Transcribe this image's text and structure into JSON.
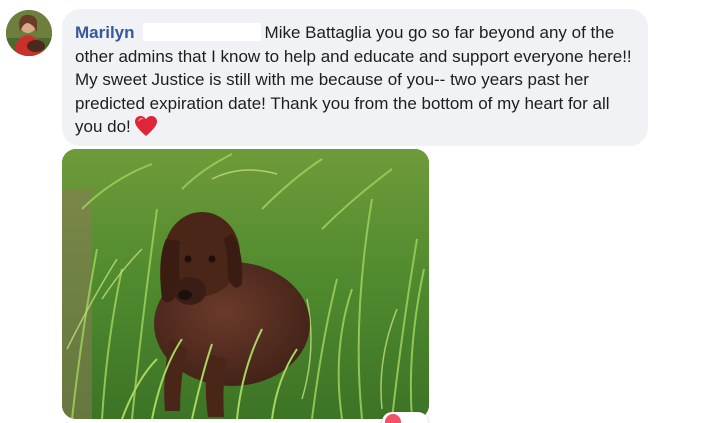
{
  "comment": {
    "author": "Marilyn",
    "text": "Mike Battaglia you go so far beyond any of the other admins that I know to help and educate and support everyone here!! My sweet Justice is still with me because of you-- two years past her predicted expiration date! Thank you from the bottom of my heart for all you do!",
    "emoji": "red-heart-icon"
  },
  "photo": {
    "subject": "dog-lying-in-grass"
  },
  "reactions": {
    "icon": "love-reaction-icon",
    "count": "",
    "color": "#f25268"
  },
  "colors": {
    "author": "#385898",
    "bubble": "#f0f2f5",
    "text": "#1c1e21"
  }
}
